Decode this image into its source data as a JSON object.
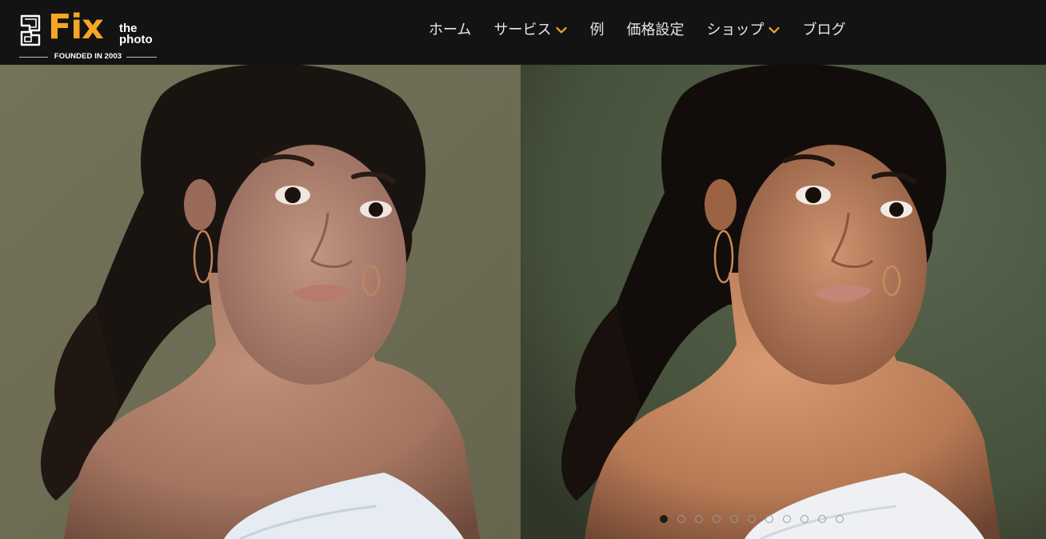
{
  "brand": {
    "fix": "Fix",
    "the": "the",
    "photo": "photo",
    "founded": "FOUNDED IN 2003",
    "accent_color": "#f6a623"
  },
  "nav": {
    "items": [
      {
        "label": "ホーム",
        "dropdown": false
      },
      {
        "label": "サービス",
        "dropdown": true
      },
      {
        "label": "例",
        "dropdown": false
      },
      {
        "label": "価格設定",
        "dropdown": false
      },
      {
        "label": "ショップ",
        "dropdown": true
      },
      {
        "label": "ブログ",
        "dropdown": false
      }
    ],
    "dropdown_icon": "chevron-down-icon"
  },
  "hero": {
    "before_background": "#6f6e57",
    "after_background": "#4d5840"
  },
  "carousel": {
    "total": 11,
    "active_index": 0
  }
}
